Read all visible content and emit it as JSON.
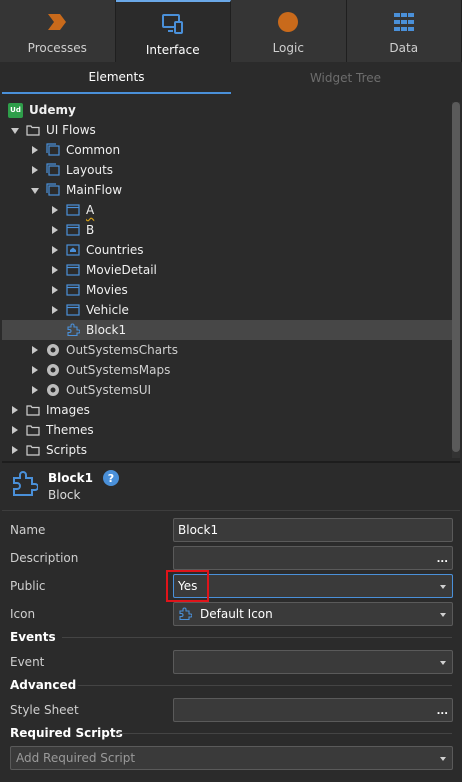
{
  "top_tabs": [
    {
      "label": "Processes",
      "icon": "processes-icon",
      "color": "#c96a1b"
    },
    {
      "label": "Interface",
      "icon": "interface-icon",
      "color": "#4a90d9"
    },
    {
      "label": "Logic",
      "icon": "logic-icon",
      "color": "#c96a1b"
    },
    {
      "label": "Data",
      "icon": "data-icon",
      "color": "#4a90d9"
    }
  ],
  "sub_tabs": [
    {
      "label": "Elements"
    },
    {
      "label": "Widget Tree"
    }
  ],
  "tree": {
    "items": [
      {
        "label": "Udemy",
        "icon": "app-badge-icon",
        "badge": "Ud"
      },
      {
        "label": "UI Flows",
        "icon": "folder-icon"
      },
      {
        "label": "Common",
        "icon": "flow-icon"
      },
      {
        "label": "Layouts",
        "icon": "flow-icon"
      },
      {
        "label": "MainFlow",
        "icon": "flow-icon"
      },
      {
        "label": "A",
        "icon": "screen-icon"
      },
      {
        "label": "B",
        "icon": "screen-icon"
      },
      {
        "label": "Countries",
        "icon": "home-screen-icon"
      },
      {
        "label": "MovieDetail",
        "icon": "screen-icon"
      },
      {
        "label": "Movies",
        "icon": "screen-icon"
      },
      {
        "label": "Vehicle",
        "icon": "screen-icon"
      },
      {
        "label": "Block1",
        "icon": "block-icon"
      },
      {
        "label": "OutSystemsCharts",
        "icon": "module-icon"
      },
      {
        "label": "OutSystemsMaps",
        "icon": "module-icon"
      },
      {
        "label": "OutSystemsUI",
        "icon": "module-icon"
      },
      {
        "label": "Images",
        "icon": "folder-icon"
      },
      {
        "label": "Themes",
        "icon": "folder-icon"
      },
      {
        "label": "Scripts",
        "icon": "folder-icon"
      }
    ]
  },
  "properties": {
    "name": "Block1",
    "type": "Block",
    "help": "?",
    "rows": {
      "name_label": "Name",
      "name_value": "Block1",
      "description_label": "Description",
      "description_value": "",
      "public_label": "Public",
      "public_value": "Yes",
      "icon_label": "Icon",
      "icon_value": "Default Icon",
      "events_section": "Events",
      "event_label": "Event",
      "event_value": "",
      "advanced_section": "Advanced",
      "stylesheet_label": "Style Sheet",
      "stylesheet_value": "",
      "required_scripts_section": "Required Scripts",
      "add_required_script_placeholder": "Add Required Script"
    },
    "ellipsis": "..."
  },
  "colors": {
    "accent": "#4a90d9",
    "highlight": "#e0141a",
    "background": "#2b2b2b"
  }
}
